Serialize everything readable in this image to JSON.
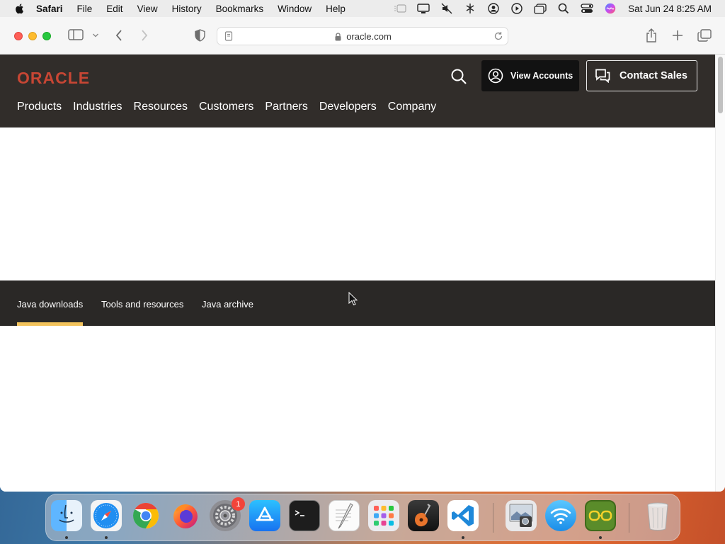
{
  "menubar": {
    "app_name": "Safari",
    "items": [
      "File",
      "Edit",
      "View",
      "History",
      "Bookmarks",
      "Window",
      "Help"
    ],
    "clock": "Sat Jun 24  8:25 AM"
  },
  "browser": {
    "url": "oracle.com"
  },
  "oracle": {
    "logo": "ORACLE",
    "view_accounts": "View Accounts",
    "contact_sales": "Contact Sales",
    "nav": [
      "Products",
      "Industries",
      "Resources",
      "Customers",
      "Partners",
      "Developers",
      "Company"
    ],
    "colors": {
      "logo_red": "#c74634",
      "header_bg": "#312d2a",
      "active_tab": "#f3c35c"
    }
  },
  "subnav": {
    "tabs": [
      "Java downloads",
      "Tools and resources",
      "Java archive"
    ],
    "active": "Java downloads"
  },
  "dock": {
    "apps": [
      "finder",
      "safari",
      "chrome",
      "firefox",
      "system-settings",
      "app-store",
      "terminal",
      "textedit",
      "launchpad",
      "garageband",
      "vscode",
      "preview",
      "wifi-utility",
      "minecraft",
      "trash"
    ],
    "system_settings_badge": "1"
  }
}
